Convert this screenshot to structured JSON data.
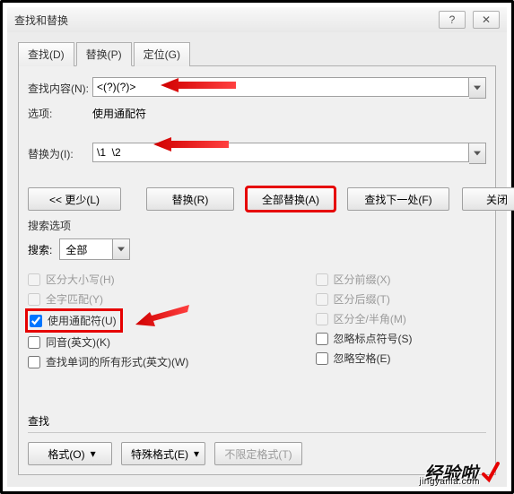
{
  "window": {
    "title": "查找和替换"
  },
  "tabs": {
    "find": "查找(D)",
    "replace": "替换(P)",
    "goto": "定位(G)"
  },
  "fields": {
    "find_label": "查找内容(N):",
    "find_value": "<(?)(?)>",
    "options_label": "选项:",
    "options_value": "使用通配符",
    "replace_label": "替换为(I):",
    "replace_value": "\\1  \\2"
  },
  "buttons": {
    "more": "<< 更少(L)",
    "replace": "替换(R)",
    "replace_all": "全部替换(A)",
    "find_next": "查找下一处(F)",
    "close": "关闭"
  },
  "search_options": {
    "title": "搜索选项",
    "search_label": "搜索:",
    "search_value": "全部",
    "left": {
      "match_case": "区分大小写(H)",
      "whole_word": "全字匹配(Y)",
      "wildcards": "使用通配符(U)",
      "sounds_like": "同音(英文)(K)",
      "word_forms": "查找单词的所有形式(英文)(W)"
    },
    "right": {
      "prefix": "区分前缀(X)",
      "suffix": "区分后缀(T)",
      "fullhalf": "区分全/半角(M)",
      "punct": "忽略标点符号(S)",
      "space": "忽略空格(E)"
    }
  },
  "footer": {
    "section": "查找",
    "format": "格式(O)",
    "special": "特殊格式(E)",
    "noformat": "不限定格式(T)"
  },
  "watermark": {
    "main": "经验啦",
    "sub": "jingyanla.com"
  }
}
